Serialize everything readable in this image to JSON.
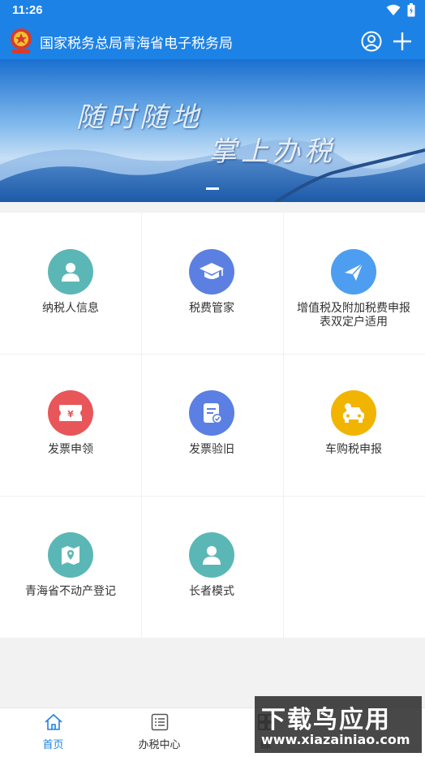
{
  "status_bar": {
    "time": "11:26"
  },
  "header": {
    "title": "国家税务总局青海省电子税务局"
  },
  "banner": {
    "line1": "随时随地",
    "line2": "掌上办税"
  },
  "grid": [
    {
      "label": "纳税人信息",
      "icon": "person-icon",
      "color": "#5bb7b6"
    },
    {
      "label": "税费管家",
      "icon": "graduation-cap-icon",
      "color": "#5b80e2"
    },
    {
      "label": "增值税及附加税费申报表双定户适用",
      "icon": "paper-plane-icon",
      "color": "#4d9ef0"
    },
    {
      "label": "发票申领",
      "icon": "ticket-icon",
      "color": "#e8565a"
    },
    {
      "label": "发票验旧",
      "icon": "document-check-icon",
      "color": "#5b7fe2"
    },
    {
      "label": "车购税申报",
      "icon": "car-icon",
      "color": "#f1b400"
    },
    {
      "label": "青海省不动产登记",
      "icon": "map-pin-icon",
      "color": "#5bb7b6"
    },
    {
      "label": "长者模式",
      "icon": "person-icon",
      "color": "#5bb7b6"
    }
  ],
  "bottom_nav": [
    {
      "label": "首页",
      "icon": "home-icon",
      "active": true
    },
    {
      "label": "办税中心",
      "icon": "list-icon",
      "active": false
    },
    {
      "label": "综",
      "icon": "grid-icon",
      "active": false
    }
  ],
  "watermark": {
    "title": "下载鸟应用",
    "url": "www.xiazainiao.com"
  },
  "colors": {
    "primary": "#1c82e6",
    "background": "#f2f2f2"
  }
}
